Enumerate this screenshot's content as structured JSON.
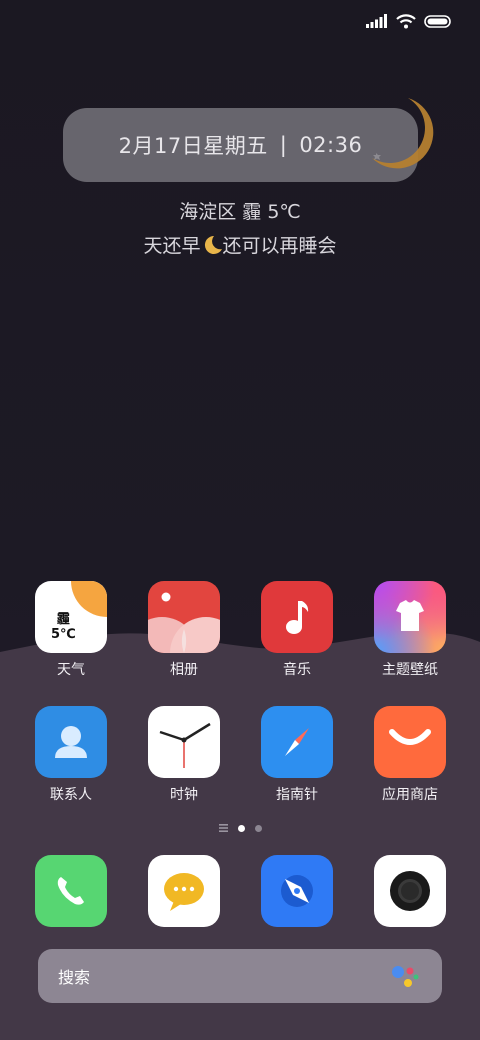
{
  "status_bar": {
    "signal_icon": "signal-icon",
    "wifi_icon": "wifi-icon",
    "battery_icon": "battery-icon"
  },
  "clock_widget": {
    "date": "2月17日星期五",
    "separator": "|",
    "time": "02:36"
  },
  "weather_widget": {
    "text": "海淀区 霾 5℃"
  },
  "greeting": {
    "before": "天还早",
    "after": "还可以再睡会"
  },
  "apps_row1": [
    {
      "label": "天气",
      "icon": "weather-icon",
      "badge_line1": "霾",
      "badge_line2": "5℃"
    },
    {
      "label": "相册",
      "icon": "gallery-icon"
    },
    {
      "label": "音乐",
      "icon": "music-icon"
    },
    {
      "label": "主题壁纸",
      "icon": "themes-icon"
    }
  ],
  "apps_row2": [
    {
      "label": "联系人",
      "icon": "contacts-icon"
    },
    {
      "label": "时钟",
      "icon": "clock-icon"
    },
    {
      "label": "指南针",
      "icon": "compass-icon"
    },
    {
      "label": "应用商店",
      "icon": "app-store-icon"
    }
  ],
  "page_indicator": {
    "pages": 2,
    "current": 1
  },
  "dock": [
    {
      "icon": "phone-icon"
    },
    {
      "icon": "messages-icon"
    },
    {
      "icon": "browser-icon"
    },
    {
      "icon": "camera-icon"
    }
  ],
  "search": {
    "placeholder": "搜索",
    "assistant_icon": "assistant-icon"
  },
  "colors": {
    "background": "#1b1822",
    "hill": "#433847",
    "weather_accent": "#f5a540",
    "gallery": "#e2453f",
    "music": "#e0393b",
    "contacts": "#2f8de4",
    "compass": "#2d8ff0",
    "store": "#ff6a3d",
    "phone": "#57d672",
    "browser": "#2f7af5"
  }
}
